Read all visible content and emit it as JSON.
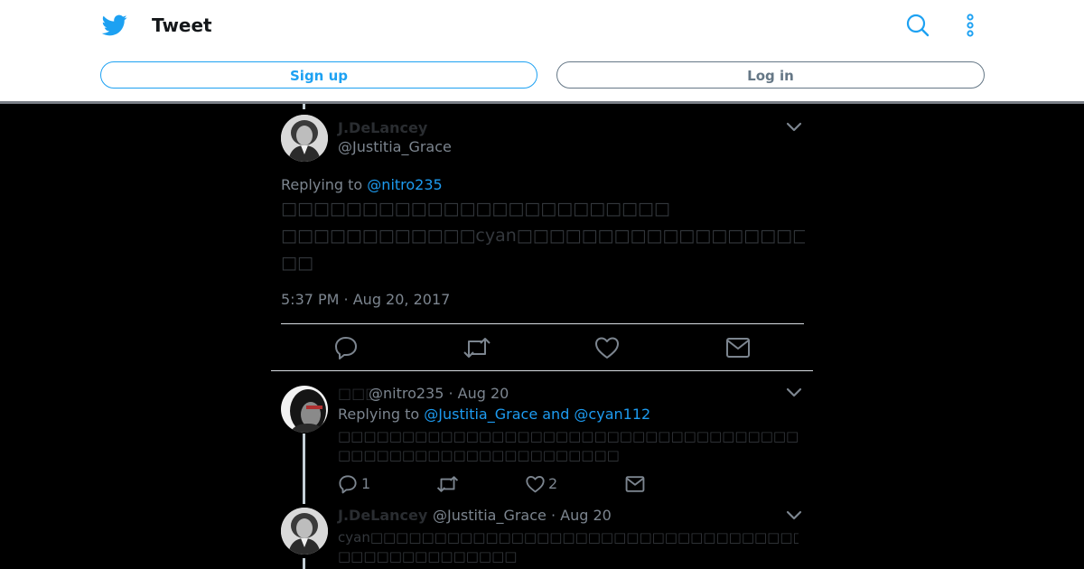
{
  "header": {
    "title": "Tweet",
    "signup_label": "Sign up",
    "login_label": "Log in",
    "brand_color": "#1da1f2"
  },
  "main_tweet": {
    "display_name": "J.DeLancey",
    "handle": "@Justitia_Grace",
    "replying_prefix": "Replying to",
    "replying_to": "@nitro235",
    "text_line1": "□□□□□□□□□□□□□□□□□□□□□□□□",
    "text_line2": "□□□□□□□□□□□□cyan□□□□□□□□□□□□□□□□□□□□□□□□□□□□□□□□",
    "text_line3": "□□",
    "timestamp": "5:37 PM · Aug 20, 2017"
  },
  "replies": [
    {
      "display_name": "□□□",
      "handle_date": "@nitro235 · Aug 20",
      "replying_prefix": "Replying to",
      "replying_to": "@Justitia_Grace and @cyan112",
      "text_line1": "□□□□□□□□□□□□□□□□□□□□□□□□□□□□□□□□□□□□□□□□□□□□□□□□□□□□□□",
      "text_line2": "□□□□□□□□□□□□□□□□□□□□□□",
      "reply_count": "1",
      "like_count": "2"
    },
    {
      "display_name": "J.DeLancey",
      "handle_date": "@Justitia_Grace · Aug 20",
      "text_line1": "cyan□□□□□□□□□□□□□□□□□□□□□□□□□□□□□□□□□□□□□□□□□□□□□□□□□□□",
      "text_line2": "□□□□□□□□□□□□□□"
    }
  ]
}
